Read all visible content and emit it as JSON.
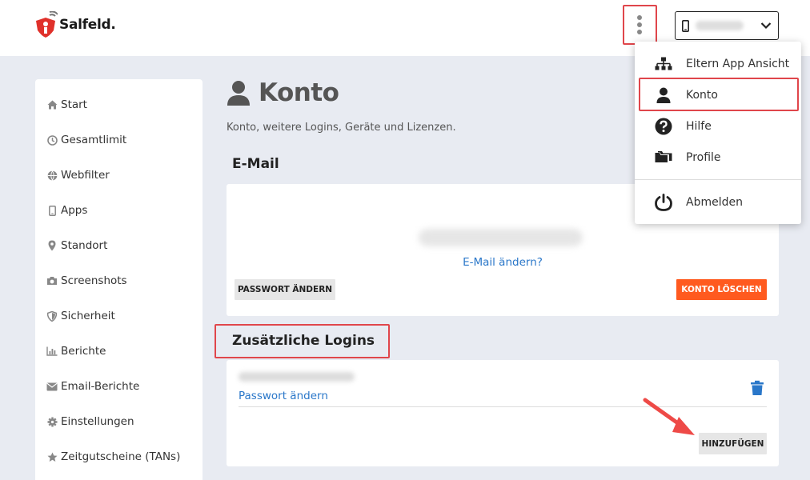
{
  "header": {
    "logo_text": "Salfeld.",
    "colors": {
      "logo_red": "#e0312b",
      "highlight_red": "#e0464b"
    }
  },
  "sidebar": {
    "items": [
      {
        "label": "Start",
        "icon": "home-icon"
      },
      {
        "label": "Gesamtlimit",
        "icon": "clock-icon"
      },
      {
        "label": "Webfilter",
        "icon": "globe-icon"
      },
      {
        "label": "Apps",
        "icon": "phone-icon"
      },
      {
        "label": "Standort",
        "icon": "map-pin-icon"
      },
      {
        "label": "Screenshots",
        "icon": "camera-icon"
      },
      {
        "label": "Sicherheit",
        "icon": "shield-icon"
      },
      {
        "label": "Berichte",
        "icon": "bar-chart-icon"
      },
      {
        "label": "Email-Berichte",
        "icon": "envelope-icon"
      },
      {
        "label": "Einstellungen",
        "icon": "gear-icon"
      },
      {
        "label": "Zeitgutscheine (TANs)",
        "icon": "star-icon"
      }
    ]
  },
  "main": {
    "title": "Konto",
    "subtitle": "Konto, weitere Logins, Geräte und Lizenzen.",
    "email_section": {
      "title": "E-Mail",
      "change_email_link": "E-Mail ändern?",
      "change_password_button": "PASSWORT ÄNDERN",
      "delete_account_button": "KONTO LÖSCHEN"
    },
    "logins_section": {
      "title": "Zusätzliche Logins",
      "change_password_link": "Passwort ändern",
      "add_button": "HINZUFÜGEN"
    },
    "colors": {
      "link": "#2a77c9",
      "danger": "#ff5a1f",
      "trash": "#2a77c9"
    }
  },
  "dropdown": {
    "items": [
      {
        "label": "Eltern App Ansicht",
        "icon": "sitemap-icon"
      },
      {
        "label": "Konto",
        "icon": "user-icon"
      },
      {
        "label": "Hilfe",
        "icon": "question-circle-icon"
      },
      {
        "label": "Profile",
        "icon": "folders-icon"
      },
      {
        "label": "Abmelden",
        "icon": "power-icon"
      }
    ]
  }
}
